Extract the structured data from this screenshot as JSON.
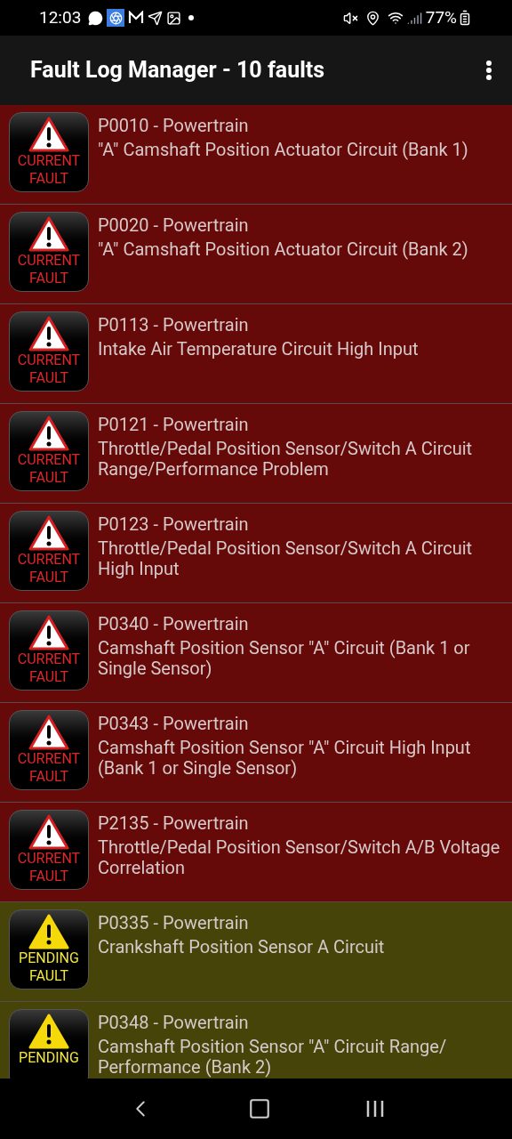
{
  "status_bar": {
    "time": "12:03",
    "battery": "77%"
  },
  "app_bar": {
    "title": "Fault Log Manager - 10 faults"
  },
  "faults": [
    {
      "kind": "current",
      "badge": [
        "CURRENT",
        "FAULT"
      ],
      "code": "P0010 - Powertrain",
      "description": "\"A\" Camshaft Position Actuator Circuit (Bank 1)"
    },
    {
      "kind": "current",
      "badge": [
        "CURRENT",
        "FAULT"
      ],
      "code": "P0020 - Powertrain",
      "description": "\"A\" Camshaft Position Actuator Circuit (Bank 2)"
    },
    {
      "kind": "current",
      "badge": [
        "CURRENT",
        "FAULT"
      ],
      "code": "P0113 - Powertrain",
      "description": "Intake Air Temperature Circuit High Input"
    },
    {
      "kind": "current",
      "badge": [
        "CURRENT",
        "FAULT"
      ],
      "code": "P0121 - Powertrain",
      "description": "Throttle/Pedal Position Sensor/Switch A Circuit Range/Performance Problem"
    },
    {
      "kind": "current",
      "badge": [
        "CURRENT",
        "FAULT"
      ],
      "code": "P0123 - Powertrain",
      "description": "Throttle/Pedal Position Sensor/Switch A Circuit High Input"
    },
    {
      "kind": "current",
      "badge": [
        "CURRENT",
        "FAULT"
      ],
      "code": "P0340 - Powertrain",
      "description": "Camshaft Position Sensor \"A\" Circuit (Bank 1 or Single Sensor)"
    },
    {
      "kind": "current",
      "badge": [
        "CURRENT",
        "FAULT"
      ],
      "code": "P0343 - Powertrain",
      "description": "Camshaft Position Sensor \"A\" Circuit High Input (Bank 1 or Single Sensor)"
    },
    {
      "kind": "current",
      "badge": [
        "CURRENT",
        "FAULT"
      ],
      "code": "P2135 - Powertrain",
      "description": "Throttle/Pedal Position Sensor/Switch A/B Voltage Correlation"
    },
    {
      "kind": "pending",
      "badge": [
        "PENDING",
        "FAULT"
      ],
      "code": "P0335 - Powertrain",
      "description": "Crankshaft Position Sensor A Circuit"
    },
    {
      "kind": "pending",
      "badge": [
        "PENDING"
      ],
      "code": "P0348 - Powertrain",
      "description": "Camshaft Position Sensor \"A\" Circuit Range/ Performance (Bank 2)"
    }
  ]
}
